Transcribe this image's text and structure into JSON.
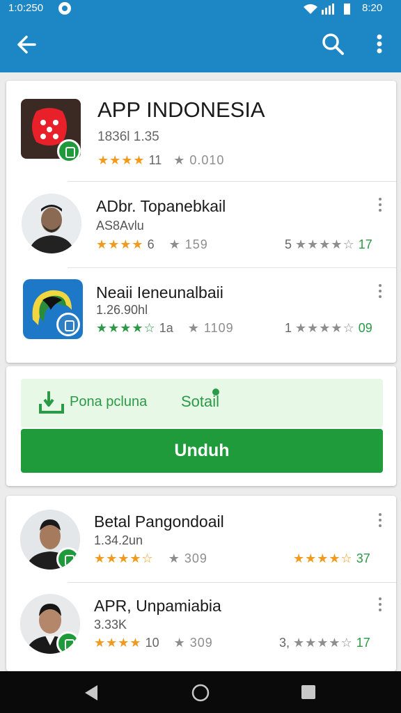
{
  "status": {
    "time": "1:0:250",
    "clock": "8:20"
  },
  "header": {
    "back_icon": "arrow-left-icon",
    "search_icon": "search-icon",
    "more_icon": "more-vert-icon",
    "bar_color": "#1d86c4"
  },
  "app": {
    "title": "APP INDONESIA",
    "meta": "1836l   1.35",
    "stars": "★★★★",
    "rating_count": "11",
    "reviews": "★ 0.010"
  },
  "list1": [
    {
      "title": "ADbr. Topanebkail",
      "sub": "AS8Avlu",
      "stars": "★★★★",
      "stars_count": "6",
      "mid": "★ 159",
      "right_prefix": "5 ",
      "right_stars": "★★★★☆",
      "right_count": " 17"
    },
    {
      "title": "Neaii Ieneunalbaii",
      "sub": "1.26.90hl",
      "stars": "★★★★☆",
      "stars_count": "1a",
      "mid": "★ 1109",
      "right_prefix": "1 ",
      "right_stars": "★★★★☆",
      "right_count": " 09"
    }
  ],
  "download": {
    "label1": "Pona pcluna",
    "label2": "Sotail",
    "button": "Unduh",
    "accent": "#1f9b3b"
  },
  "list2": [
    {
      "title": "Betal Pangondoail",
      "sub": "1.34.2un",
      "stars": "★★★★☆",
      "stars_count": "",
      "mid": "★ 309",
      "right_prefix": "",
      "right_stars": "★★★★☆",
      "right_count": " 37"
    },
    {
      "title": "APR, Unpamiabia",
      "sub": "3.33K",
      "stars": "★★★★",
      "stars_count": "10",
      "mid": "★ 309",
      "right_prefix": "3, ",
      "right_stars": "★★★★☆",
      "right_count": " 17"
    }
  ],
  "nav": {
    "back": "nav-back-icon",
    "home": "nav-home-icon",
    "recent": "nav-recent-icon"
  }
}
